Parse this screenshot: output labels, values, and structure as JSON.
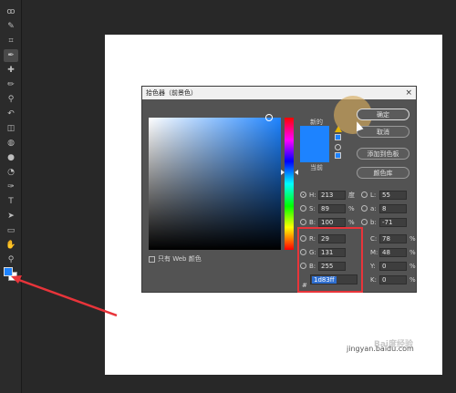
{
  "toolbar": {
    "tools": [
      {
        "name": "lasso-tool-icon",
        "glyph": "ꝏ"
      },
      {
        "name": "quick-select-icon",
        "glyph": "✎"
      },
      {
        "name": "crop-icon",
        "glyph": "⌗"
      },
      {
        "name": "eyedropper-icon",
        "glyph": "✒"
      },
      {
        "name": "healing-brush-icon",
        "glyph": "✚"
      },
      {
        "name": "brush-icon",
        "glyph": "✏"
      },
      {
        "name": "clone-stamp-icon",
        "glyph": "⚲"
      },
      {
        "name": "history-brush-icon",
        "glyph": "↶"
      },
      {
        "name": "eraser-icon",
        "glyph": "◫"
      },
      {
        "name": "paint-bucket-icon",
        "glyph": "◍"
      },
      {
        "name": "blur-icon",
        "glyph": "●"
      },
      {
        "name": "dodge-icon",
        "glyph": "◔"
      },
      {
        "name": "pen-icon",
        "glyph": "✑"
      },
      {
        "name": "type-icon",
        "glyph": "T"
      },
      {
        "name": "path-select-icon",
        "glyph": "➤"
      },
      {
        "name": "shape-icon",
        "glyph": "▭"
      },
      {
        "name": "hand-icon",
        "glyph": "✋"
      },
      {
        "name": "zoom-icon",
        "glyph": "⚲"
      },
      {
        "name": "more-tools-icon",
        "glyph": "⋯"
      }
    ]
  },
  "dialog": {
    "title": "拾色器（前景色）",
    "close": "×",
    "new_label": "新的",
    "current_label": "当前",
    "only_web": "只有 Web 颜色",
    "buttons": {
      "ok": "确定",
      "cancel": "取消",
      "add_swatch": "添加到色板",
      "color_library": "颜色库"
    },
    "hsb": [
      {
        "label": "H:",
        "value": "213",
        "unit": "度"
      },
      {
        "label": "S:",
        "value": "89",
        "unit": "%"
      },
      {
        "label": "B:",
        "value": "100",
        "unit": "%"
      }
    ],
    "rgb": [
      {
        "label": "R:",
        "value": "29"
      },
      {
        "label": "G:",
        "value": "131"
      },
      {
        "label": "B:",
        "value": "255"
      }
    ],
    "lab": [
      {
        "label": "L:",
        "value": "55"
      },
      {
        "label": "a:",
        "value": "8"
      },
      {
        "label": "b:",
        "value": "-71"
      }
    ],
    "cmyk": [
      {
        "label": "C:",
        "value": "78",
        "unit": "%"
      },
      {
        "label": "M:",
        "value": "48",
        "unit": "%"
      },
      {
        "label": "Y:",
        "value": "0",
        "unit": "%"
      },
      {
        "label": "K:",
        "value": "0",
        "unit": "%"
      }
    ],
    "hex_prefix": "#",
    "hex_value": "1d83ff"
  },
  "colors": {
    "picked": "#1d83ff",
    "highlight_box": "#e8343a"
  },
  "watermark": {
    "logo": "Bai度经验",
    "url": "jingyan.baidu.com"
  }
}
